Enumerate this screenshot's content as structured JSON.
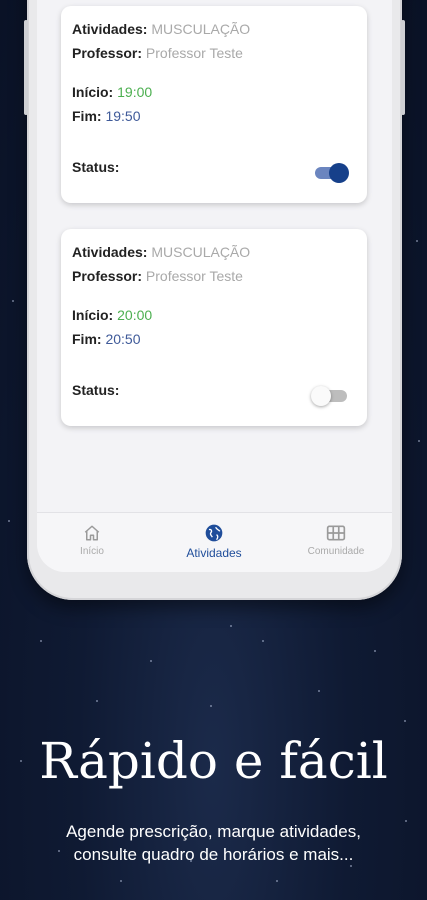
{
  "cards": [
    {
      "activity_label": "Atividades:",
      "activity_value": "MUSCULAÇÃO",
      "teacher_label": "Professor:",
      "teacher_value": "Professor Teste",
      "start_label": "Início:",
      "start_value": "19:00",
      "end_label": "Fim:",
      "end_value": "19:50",
      "status_label": "Status:",
      "status_on": true
    },
    {
      "activity_label": "Atividades:",
      "activity_value": "MUSCULAÇÃO",
      "teacher_label": "Professor:",
      "teacher_value": "Professor Teste",
      "start_label": "Início:",
      "start_value": "20:00",
      "end_label": "Fim:",
      "end_value": "20:50",
      "status_label": "Status:",
      "status_on": false
    }
  ],
  "nav": {
    "items": [
      {
        "label": "Início",
        "icon": "home-icon",
        "active": false
      },
      {
        "label": "Atividades",
        "icon": "globe-icon",
        "active": true
      },
      {
        "label": "Comunidade",
        "icon": "grid-icon",
        "active": false
      }
    ]
  },
  "promo": {
    "headline": "Rápido e fácil",
    "line1": "Agende prescrição, marque atividades,",
    "line2": "consulte quadro de horários e mais..."
  },
  "colors": {
    "accent": "#1f4d9a",
    "start_time": "#4caf50",
    "end_time": "#3f5a99",
    "background": "#0f1a33"
  }
}
